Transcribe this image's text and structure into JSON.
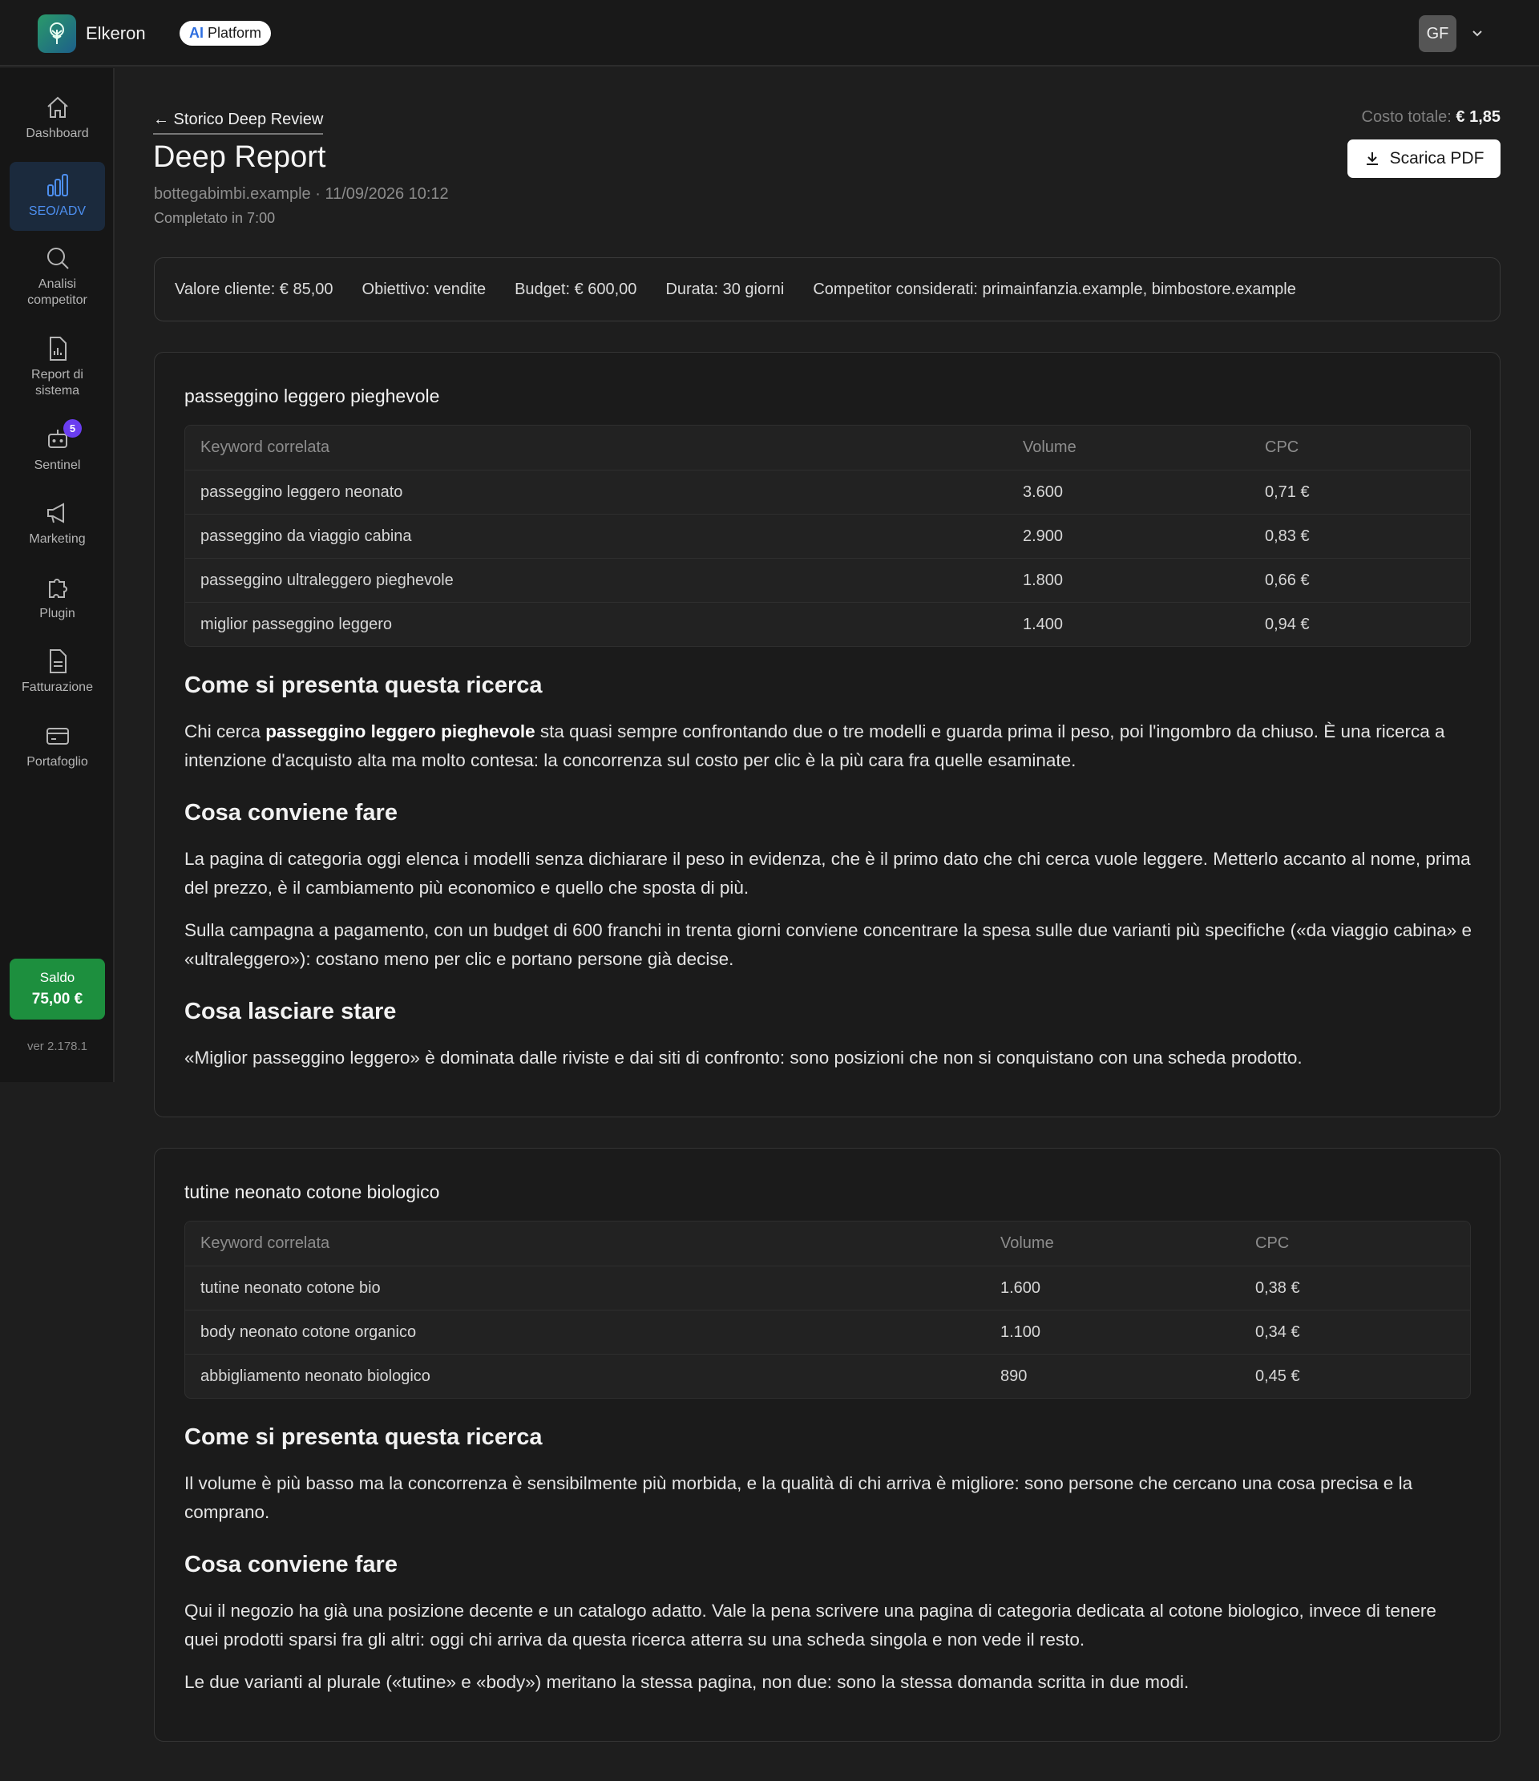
{
  "header": {
    "brand": "Elkeron",
    "platform_badge_prefix": "AI",
    "platform_badge_text": "Platform",
    "avatar_initials": "GF"
  },
  "sidebar": {
    "items": [
      {
        "label": "Dashboard",
        "icon": "home-icon"
      },
      {
        "label": "SEO/ADV",
        "icon": "bar-chart-icon",
        "active": true
      },
      {
        "label": "Analisi competitor",
        "icon": "search-icon"
      },
      {
        "label": "Report di sistema",
        "icon": "report-icon"
      },
      {
        "label": "Sentinel",
        "icon": "robot-icon",
        "badge": "5"
      },
      {
        "label": "Marketing",
        "icon": "megaphone-icon"
      },
      {
        "label": "Plugin",
        "icon": "puzzle-icon"
      },
      {
        "label": "Fatturazione",
        "icon": "invoice-icon"
      },
      {
        "label": "Portafoglio",
        "icon": "wallet-icon"
      }
    ],
    "saldo_label": "Saldo",
    "saldo_value": "75,00 €",
    "version": "ver 2.178.1",
    "accent_color": "#4d8ff0",
    "saldo_color": "#1d8f3e"
  },
  "report": {
    "back_label": "← Storico Deep Review",
    "title": "Deep Report",
    "meta": "bottegabimbi.example · 11/09/2026 10:12",
    "completed": "Completato in 7:00",
    "cost_label": "Costo totale:",
    "cost_value": "€ 1,85",
    "pdf_label": "Scarica PDF"
  },
  "summary": {
    "valore": "Valore cliente: € 85,00",
    "obiettivo": "Obiettivo: vendite",
    "budget": "Budget: € 600,00",
    "durata": "Durata: 30 giorni",
    "competitor": "Competitor considerati: primainfanzia.example, bimbostore.example"
  },
  "cards": [
    {
      "title": "passeggino leggero pieghevole",
      "columns": [
        "Keyword correlata",
        "Volume",
        "CPC"
      ],
      "rows": [
        [
          "passeggino leggero neonato",
          "3.600",
          "0,71 €"
        ],
        [
          "passeggino da viaggio cabina",
          "2.900",
          "0,83 €"
        ],
        [
          "passeggino ultraleggero pieghevole",
          "1.800",
          "0,66 €"
        ],
        [
          "miglior passeggino leggero",
          "1.400",
          "0,94 €"
        ]
      ],
      "h1": "Come si presenta questa ricerca",
      "p1_pre": "Chi cerca ",
      "p1_bold": "passeggino leggero pieghevole",
      "p1_post": " sta quasi sempre confrontando due o tre modelli e guarda prima il peso, poi l'ingombro da chiuso. È una ricerca a intenzione d'acquisto alta ma molto contesa: la concorrenza sul costo per clic è la più cara fra quelle esaminate.",
      "h2": "Cosa conviene fare",
      "p2": "La pagina di categoria oggi elenca i modelli senza dichiarare il peso in evidenza, che è il primo dato che chi cerca vuole leggere. Metterlo accanto al nome, prima del prezzo, è il cambiamento più economico e quello che sposta di più.",
      "p3": "Sulla campagna a pagamento, con un budget di 600 franchi in trenta giorni conviene concentrare la spesa sulle due varianti più specifiche («da viaggio cabina» e «ultraleggero»): costano meno per clic e portano persone già decise.",
      "h3": "Cosa lasciare stare",
      "p4": "«Miglior passeggino leggero» è dominata dalle riviste e dai siti di confronto: sono posizioni che non si conquistano con una scheda prodotto."
    },
    {
      "title": "tutine neonato cotone biologico",
      "columns": [
        "Keyword correlata",
        "Volume",
        "CPC"
      ],
      "rows": [
        [
          "tutine neonato cotone bio",
          "1.600",
          "0,38 €"
        ],
        [
          "body neonato cotone organico",
          "1.100",
          "0,34 €"
        ],
        [
          "abbigliamento neonato biologico",
          "890",
          "0,45 €"
        ]
      ],
      "h1": "Come si presenta questa ricerca",
      "p1": "Il volume è più basso ma la concorrenza è sensibilmente più morbida, e la qualità di chi arriva è migliore: sono persone che cercano una cosa precisa e la comprano.",
      "h2": "Cosa conviene fare",
      "p2": "Qui il negozio ha già una posizione decente e un catalogo adatto. Vale la pena scrivere una pagina di categoria dedicata al cotone biologico, invece di tenere quei prodotti sparsi fra gli altri: oggi chi arriva da questa ricerca atterra su una scheda singola e non vede il resto.",
      "p3": "Le due varianti al plurale («tutine» e «body») meritano la stessa pagina, non due: sono la stessa domanda scritta in due modi."
    }
  ]
}
